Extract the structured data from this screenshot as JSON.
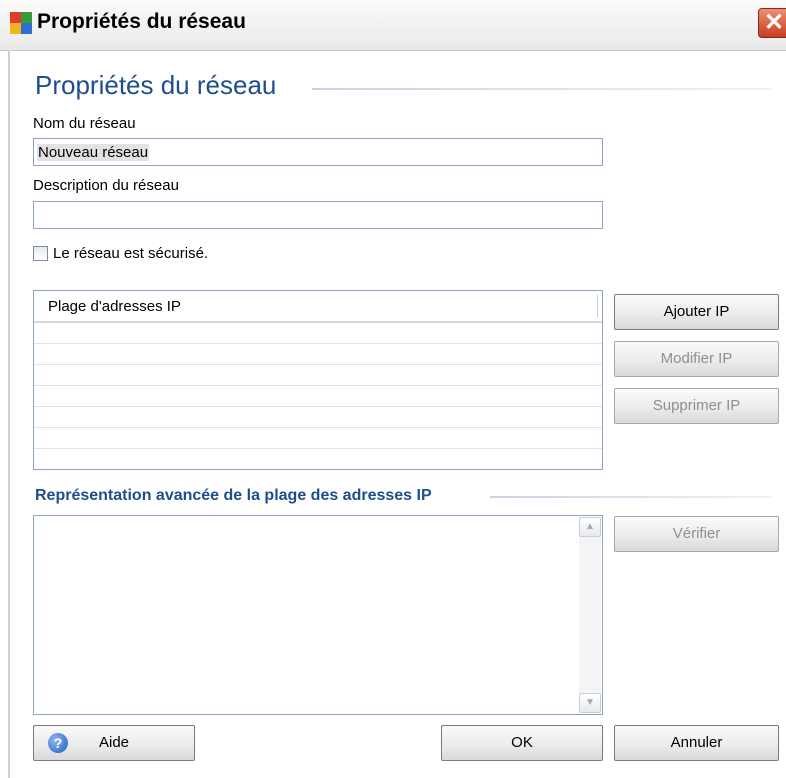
{
  "window": {
    "title": "Propriétés du réseau",
    "close_glyph": "✕"
  },
  "header": {
    "title": "Propriétés du réseau"
  },
  "form": {
    "name_label": "Nom du réseau",
    "name_value": "Nouveau réseau",
    "description_label": "Description du réseau",
    "description_value": "",
    "secured_label": "Le réseau est sécurisé.",
    "secured_checked": false
  },
  "ip_list": {
    "column_header": "Plage d'adresses IP",
    "rows": []
  },
  "ip_buttons": {
    "add": "Ajouter IP",
    "edit": "Modifier IP",
    "delete": "Supprimer IP"
  },
  "advanced": {
    "title": "Représentation avancée de la plage des adresses IP",
    "text": "",
    "verify": "Vérifier",
    "scroll_up_glyph": "▲",
    "scroll_down_glyph": "▼"
  },
  "footer": {
    "help": "Aide",
    "help_glyph": "?",
    "ok": "OK",
    "cancel": "Annuler"
  },
  "colors": {
    "accent": "#1f4e8c",
    "close_button": "#c93c1f"
  },
  "icons": {
    "app": "avg-logo-icon",
    "close": "close-icon",
    "help": "help-icon"
  }
}
